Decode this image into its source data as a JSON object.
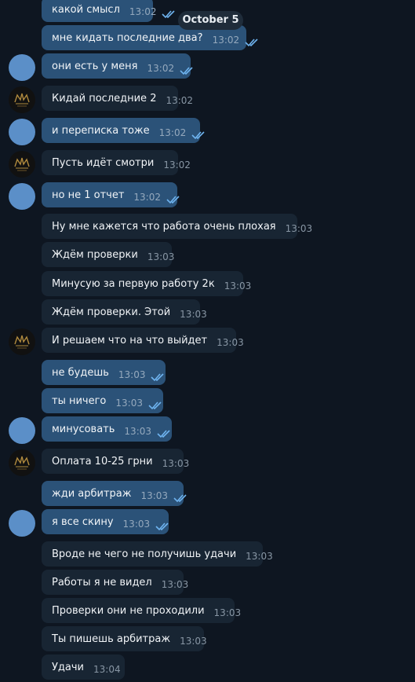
{
  "date_separator": "October 5",
  "checks_color": "#6fb4f0",
  "messages": [
    {
      "dir": "out",
      "text": "какой смысл",
      "time": "13:02",
      "avatar": "none",
      "read": true
    },
    {
      "dir": "out",
      "text": "мне кидать последние два?",
      "time": "13:02",
      "avatar": "none",
      "read": true
    },
    {
      "dir": "out",
      "text": "они есть у меня",
      "time": "13:02",
      "avatar": "blue-circle",
      "read": true
    },
    {
      "dir": "in",
      "text": "Кидай последние 2",
      "time": "13:02",
      "avatar": "logo",
      "read": false
    },
    {
      "dir": "out",
      "text": "и переписка тоже",
      "time": "13:02",
      "avatar": "blue-circle",
      "read": true
    },
    {
      "dir": "in",
      "text": "Пусть идёт смотри",
      "time": "13:02",
      "avatar": "logo",
      "read": false
    },
    {
      "dir": "out",
      "text": "но не 1 отчет",
      "time": "13:02",
      "avatar": "blue-circle",
      "read": true
    },
    {
      "dir": "in",
      "text": "Ну мне кажется что работа очень плохая",
      "time": "13:03",
      "avatar": "none",
      "read": false
    },
    {
      "dir": "in",
      "text": "Ждём проверки",
      "time": "13:03",
      "avatar": "none",
      "read": false
    },
    {
      "dir": "in",
      "text": "Минусую за первую работу 2к",
      "time": "13:03",
      "avatar": "none",
      "read": false
    },
    {
      "dir": "in",
      "text": "Ждём проверки. Этой",
      "time": "13:03",
      "avatar": "none",
      "read": false
    },
    {
      "dir": "in",
      "text": "И решаем что на что выйдет",
      "time": "13:03",
      "avatar": "logo",
      "read": false
    },
    {
      "dir": "out",
      "text": "не будешь",
      "time": "13:03",
      "avatar": "none",
      "read": true
    },
    {
      "dir": "out",
      "text": "ты ничего",
      "time": "13:03",
      "avatar": "none",
      "read": true
    },
    {
      "dir": "out",
      "text": "минусовать",
      "time": "13:03",
      "avatar": "blue-circle",
      "read": true
    },
    {
      "dir": "in",
      "text": "Оплата 10-25 грни",
      "time": "13:03",
      "avatar": "logo",
      "read": false
    },
    {
      "dir": "out",
      "text": "жди арбитраж",
      "time": "13:03",
      "avatar": "none",
      "read": true
    },
    {
      "dir": "out",
      "text": "я все скину",
      "time": "13:03",
      "avatar": "blue-circle",
      "read": true
    },
    {
      "dir": "in",
      "text": "Вроде не чего не получишь удачи",
      "time": "13:03",
      "avatar": "none",
      "read": false
    },
    {
      "dir": "in",
      "text": "Работы я не видел",
      "time": "13:03",
      "avatar": "none",
      "read": false
    },
    {
      "dir": "in",
      "text": "Проверки они не проходили",
      "time": "13:03",
      "avatar": "none",
      "read": false
    },
    {
      "dir": "in",
      "text": "Ты пишешь арбитраж",
      "time": "13:03",
      "avatar": "none",
      "read": false
    },
    {
      "dir": "in",
      "text": "Удачи",
      "time": "13:04",
      "avatar": "none",
      "read": false
    }
  ]
}
